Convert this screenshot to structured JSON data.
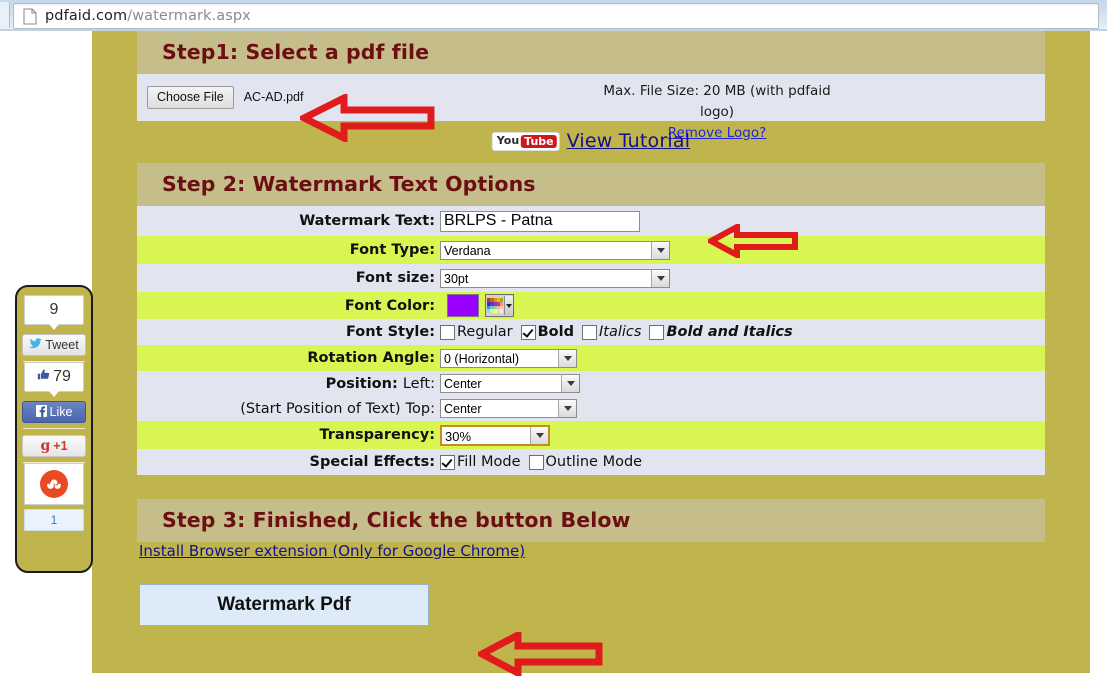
{
  "browser": {
    "url_host": "pdfaid.com",
    "url_path": "/watermark.aspx",
    "page_icon": "page-icon"
  },
  "step1": {
    "header": "Step1: Select a pdf file",
    "choose_file_label": "Choose File",
    "file_name": "AC-AD.pdf",
    "max_size_text": "Max. File Size: 20 MB (with pdfaid logo)",
    "remove_logo_link": "Remove Logo?"
  },
  "tutorial": {
    "youtube_you": "You",
    "youtube_tube": "Tube",
    "link": "View Tutorial"
  },
  "step2": {
    "header": "Step 2: Watermark Text Options",
    "fields": {
      "watermark_text_label": "Watermark Text:",
      "watermark_text_value": "BRLPS - Patna",
      "font_type_label": "Font Type:",
      "font_type_value": "Verdana",
      "font_size_label": "Font size:",
      "font_size_value": "30pt",
      "font_color_label": "Font Color:",
      "font_color_value": "#9900FF",
      "font_style_label": "Font Style:",
      "rotation_label": "Rotation Angle:",
      "rotation_value": "0 (Horizontal)",
      "position_label": "Position:",
      "position_left_label": "Left:",
      "position_left_value": "Center",
      "position_sub_label": "(Start Position of Text)",
      "position_top_label": "Top:",
      "position_top_value": "Center",
      "transparency_label": "Transparency:",
      "transparency_value": "30%",
      "special_effects_label": "Special Effects:"
    },
    "font_styles": [
      {
        "label": "Regular",
        "checked": false
      },
      {
        "label": "Bold",
        "checked": true
      },
      {
        "label": "Italics",
        "checked": false
      },
      {
        "label": "Bold and Italics",
        "checked": false
      }
    ],
    "special_effects": [
      {
        "label": "Fill Mode",
        "checked": true
      },
      {
        "label": "Outline Mode",
        "checked": false
      }
    ]
  },
  "step3": {
    "header": "Step 3: Finished, Click the button Below",
    "extension_link": "Install Browser extension (Only for Google Chrome)",
    "submit_button": "Watermark Pdf"
  },
  "social": {
    "tweet_count": "9",
    "tweet_label": "Tweet",
    "like_count": "79",
    "like_label": "Like",
    "gplus_label": "+1",
    "gplus_icon": "g",
    "stumble_icon": "su",
    "stumble_count": "1"
  },
  "annotations": {
    "arrow_color": "#e01b1b",
    "arrows": [
      "arrow-to-file-chooser",
      "arrow-to-watermark-text",
      "arrow-to-submit-button"
    ]
  }
}
